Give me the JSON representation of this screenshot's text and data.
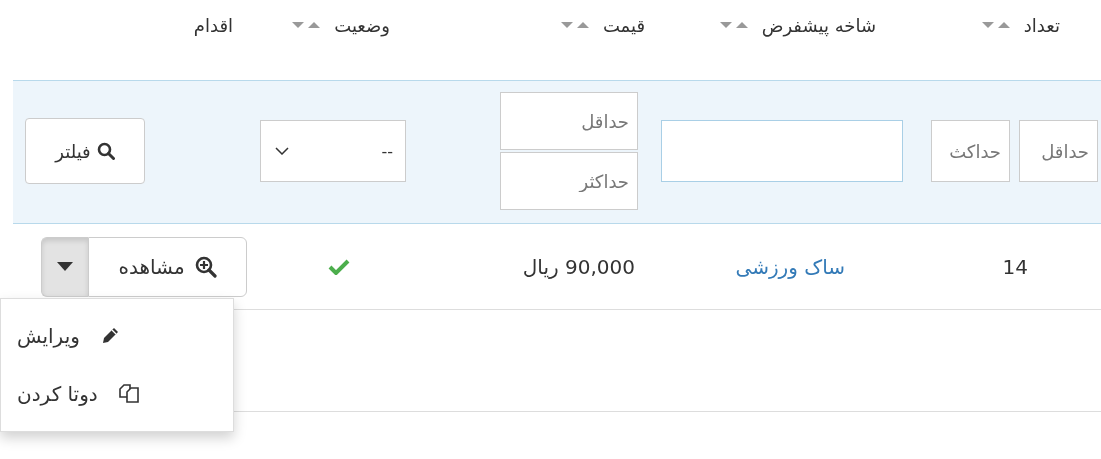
{
  "table": {
    "columns": [
      {
        "label": "تعداد",
        "sortable": true
      },
      {
        "label": "شاخه پیشفرض",
        "sortable": true
      },
      {
        "label": "قیمت",
        "sortable": true
      },
      {
        "label": "وضعیت",
        "sortable": true
      },
      {
        "label": "اقدام",
        "sortable": false
      }
    ],
    "filters": {
      "count_min": {
        "placeholder": "حداقل"
      },
      "count_max": {
        "placeholder": "حداکث"
      },
      "price_min": {
        "placeholder": "حداقل"
      },
      "price_max": {
        "placeholder": "حداکثر"
      },
      "status": {
        "value": "--"
      },
      "filter_button": "فیلتر"
    },
    "rows": [
      {
        "count": "14",
        "branch": "ساک ورزشی",
        "price": "90,000 ریال",
        "active": true,
        "actions": {
          "view_label": "مشاهده",
          "expanded": true,
          "menu": [
            {
              "kind": "edit",
              "label": "ویرایش"
            },
            {
              "kind": "duplicate",
              "label": "دوتا کردن"
            }
          ]
        }
      }
    ]
  }
}
